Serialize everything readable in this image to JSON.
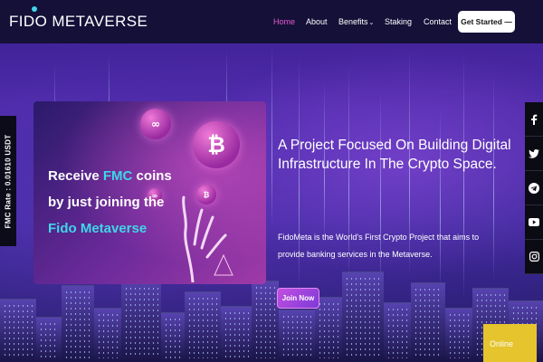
{
  "header": {
    "logo": "FIDO METAVERSE",
    "nav": [
      {
        "label": "Home",
        "active": true
      },
      {
        "label": "About",
        "active": false
      },
      {
        "label": "Benefits",
        "active": false,
        "has_caret": true
      },
      {
        "label": "Staking",
        "active": false
      },
      {
        "label": "Contact",
        "active": false
      }
    ],
    "cta_label": "Get Started —"
  },
  "rate_tab": "FMC Rate : 0.01610 USDT",
  "hero_card": {
    "line1_prefix": "Receive ",
    "line1_highlight": "FMC",
    "line1_suffix": " coins",
    "line2": "by just joining the",
    "line3": "Fido Metaverse"
  },
  "hero": {
    "title": "A Project Focused On Building Digital Infrastructure In The Crypto Space.",
    "description": "FidoMeta is the World's First Crypto Project that aims to provide banking services in the Metaverse.",
    "join_label": "Join Now"
  },
  "social": [
    {
      "icon": "facebook-icon"
    },
    {
      "icon": "twitter-icon"
    },
    {
      "icon": "telegram-icon"
    },
    {
      "icon": "youtube-icon"
    },
    {
      "icon": "instagram-icon"
    }
  ],
  "online_label": "Online",
  "colors": {
    "accent_cyan": "#3fd6e8",
    "nav_active": "#e85bd0",
    "header_bg": "#141038",
    "online_bg": "#e5c42e"
  }
}
